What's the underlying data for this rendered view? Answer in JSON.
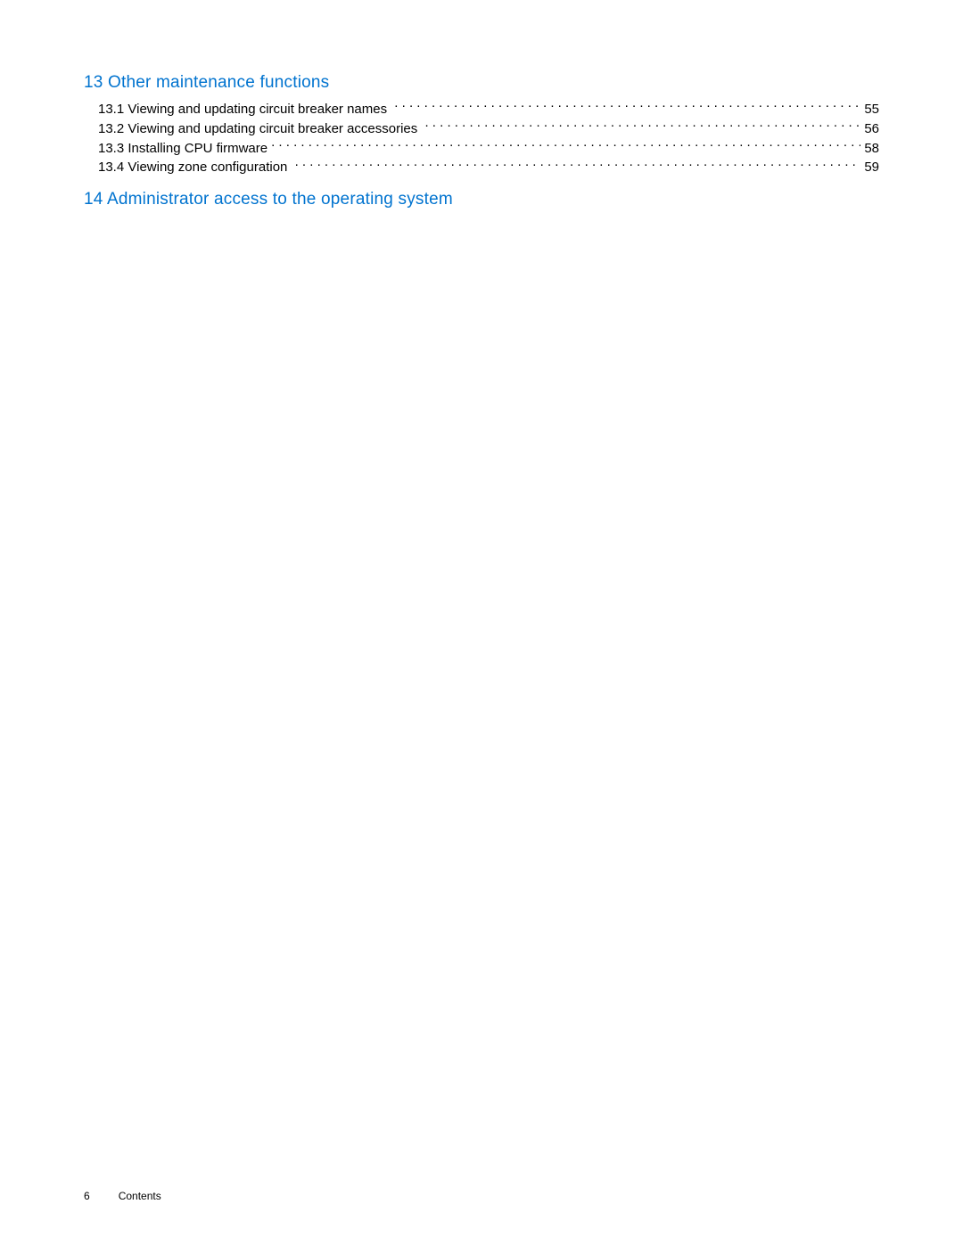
{
  "sections": [
    {
      "number": "13",
      "title": "Other maintenance functions",
      "subsections": [
        {
          "number": "13.1",
          "text": "Viewing and updating circuit breaker names",
          "page": "55"
        },
        {
          "number": "13.2",
          "text": "Viewing and updating circuit breaker accessories",
          "page": "56"
        },
        {
          "number": "13.3",
          "text": "Installing CPU firmware",
          "page": "58"
        },
        {
          "number": "13.4",
          "text": "Viewing zone configuration",
          "page": "59"
        }
      ]
    },
    {
      "number": "14",
      "title": "Administrator access to the operating system",
      "subsections": []
    }
  ],
  "footer": {
    "page": "6",
    "label": "Contents"
  }
}
